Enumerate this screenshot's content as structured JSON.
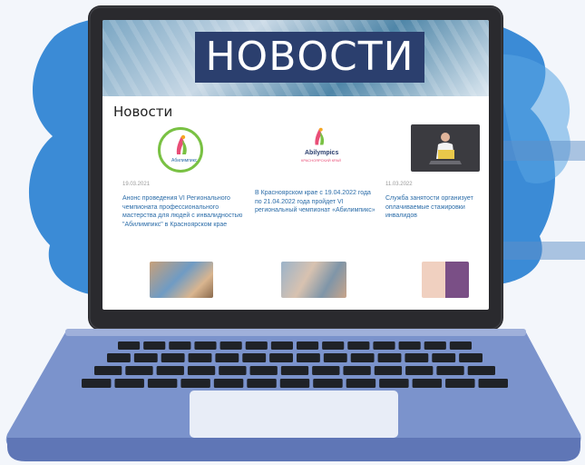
{
  "banner": {
    "title": "НОВОСТИ"
  },
  "section": {
    "title": "Новости"
  },
  "news": [
    {
      "logo_caption": "Абилимпикс",
      "date": "19.03.2021",
      "text": "Анонс проведения VI Регионального чемпионата профессионального мастерства для людей с инвалидностью \"Абилимпикс\" в Красноярском крае"
    },
    {
      "logo_caption": "Abilympics",
      "logo_subcaption": "КРАСНОЯРСКИЙ КРАЙ",
      "date": "",
      "text": "В Красноярском крае с 19.04.2022 года по 21.04.2022 года пройдет VI региональный чемпионат «Абилимпикс»"
    },
    {
      "date": "11.03.2022",
      "text": "Служба занятости организует оплачиваемые стажировки инвалидов"
    }
  ],
  "colors": {
    "banner_box": "#2b3f6e",
    "link": "#2b6ca8",
    "laptop_body": "#7b93cc",
    "bezel": "#2a2a2e",
    "blob": "#3f8fd8"
  }
}
